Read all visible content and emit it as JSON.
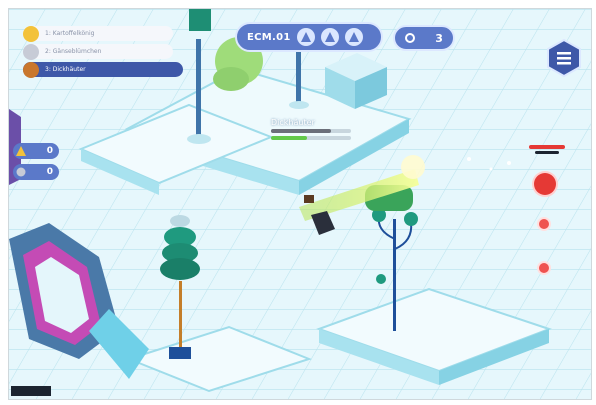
{
  "leaderboard": [
    {
      "label": "1: Kartoffelkönig",
      "color": "#f3c23a"
    },
    {
      "label": "2: Gänseblümchen",
      "color": "#c7cbd6"
    },
    {
      "label": "3: Dickhäuter",
      "color": "#c9772d"
    }
  ],
  "stage": {
    "label": "ECM.01"
  },
  "wave_icons": [
    "tower-icon",
    "tower-icon",
    "tower-icon"
  ],
  "score": {
    "value": "3"
  },
  "side_counters": [
    {
      "icon": "warning-icon",
      "value": "0"
    },
    {
      "icon": "coin-icon",
      "value": "0"
    }
  ],
  "enemy": {
    "label": "Dickhäuter",
    "health": 0.75,
    "shield": 0.45
  },
  "player_health_dash": {
    "color": "#e53935"
  },
  "abilities": [
    {
      "name": "fire-ability-icon",
      "color": "#e53935"
    },
    {
      "name": "bolt-ability-icon",
      "color": "#ef5350"
    },
    {
      "name": "star-ability-icon",
      "color": "#ef5350"
    }
  ],
  "menu_icon": "hamburger-icon",
  "colors": {
    "ice": "#dff4fb",
    "ice_dark": "#9fdcea",
    "hud_blue": "#5b79c9",
    "accent_green": "#62c94a",
    "tree": "#1f9a7f"
  }
}
